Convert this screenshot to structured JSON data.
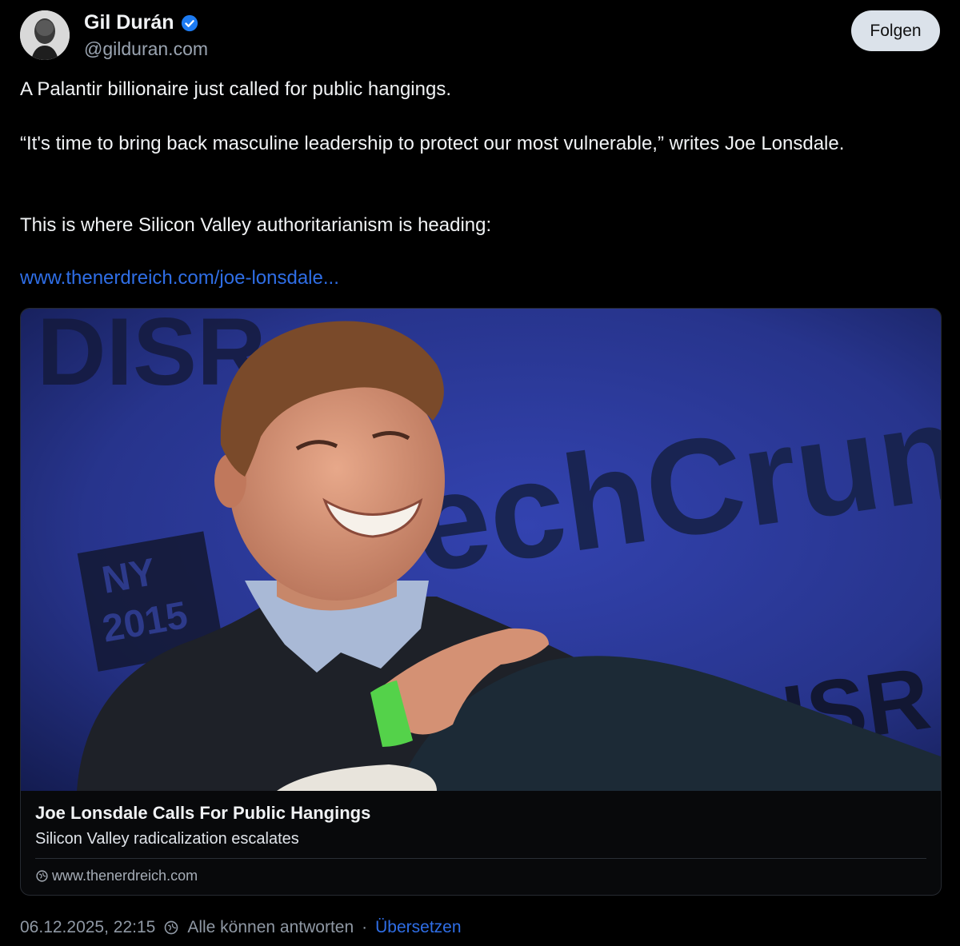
{
  "author": {
    "name": "Gil Durán",
    "handle": "@gilduran.com",
    "avatar_icon": "avatar-photo",
    "verified_icon": "verified-badge-icon"
  },
  "follow_label": "Folgen",
  "post": {
    "paragraphs": [
      "A Palantir billionaire just called for public hangings.",
      "“It's time to bring back masculine leadership to protect our most vulnerable,” writes Joe Lonsdale.",
      "This is where Silicon Valley authoritarianism is heading:"
    ],
    "link_text": "www.thenerdreich.com/joe-lonsdale..."
  },
  "card": {
    "image_background_text": [
      "DISR",
      "echCrun",
      "NY",
      "2015",
      "DISR"
    ],
    "title": "Joe Lonsdale Calls For Public Hangings",
    "description": "Silicon Valley radicalization escalates",
    "domain": "www.thenerdreich.com"
  },
  "footer": {
    "timestamp": "06.12.2025, 22:15",
    "reply_setting": "Alle können antworten",
    "separator": "·",
    "translate_label": "Übersetzen"
  },
  "colors": {
    "background": "#000000",
    "link": "#2f6ee6",
    "verified": "#1d7bf2",
    "follow_button": "#dbe2ea",
    "image_backdrop": "#27348c"
  }
}
